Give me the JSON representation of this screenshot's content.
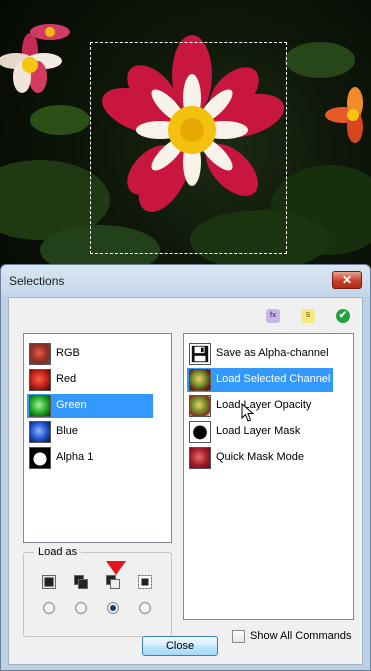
{
  "dialog": {
    "title": "Selections",
    "close_glyph": "✕"
  },
  "toolbar": {
    "icons": [
      "fx-icon",
      "s-icon",
      "check-icon"
    ],
    "fx_text": "fx",
    "s_text": "S",
    "check_text": "✔"
  },
  "channels": {
    "items": [
      {
        "label": "RGB",
        "icon": "rgb-thumbnail"
      },
      {
        "label": "Red",
        "icon": "red-thumbnail"
      },
      {
        "label": "Green",
        "icon": "green-thumbnail",
        "selected": true
      },
      {
        "label": "Blue",
        "icon": "blue-thumbnail"
      },
      {
        "label": "Alpha 1",
        "icon": "alpha-thumbnail"
      }
    ]
  },
  "load_as": {
    "label": "Load as",
    "modes": [
      "replace-icon",
      "add-icon",
      "subtract-icon",
      "intersect-icon"
    ],
    "selected_index": 2
  },
  "commands": {
    "items": [
      {
        "label": "Save as Alpha-channel",
        "icon": "save-floppy-icon"
      },
      {
        "label": "Load Selected Channel",
        "icon": "apple-thumbnail",
        "selected": true
      },
      {
        "label": "Load Layer Opacity",
        "icon": "apple-thumbnail"
      },
      {
        "label": "Load Layer Mask",
        "icon": "mask-thumbnail"
      },
      {
        "label": "Quick Mask Mode",
        "icon": "apple-red-thumbnail"
      }
    ]
  },
  "show_all": {
    "label": "Show All Commands",
    "checked": false
  },
  "buttons": {
    "close": "Close"
  },
  "colors": {
    "selection": "#3399ff",
    "dialog_frame": "#bcd0e4",
    "marker": "#e6161c"
  }
}
